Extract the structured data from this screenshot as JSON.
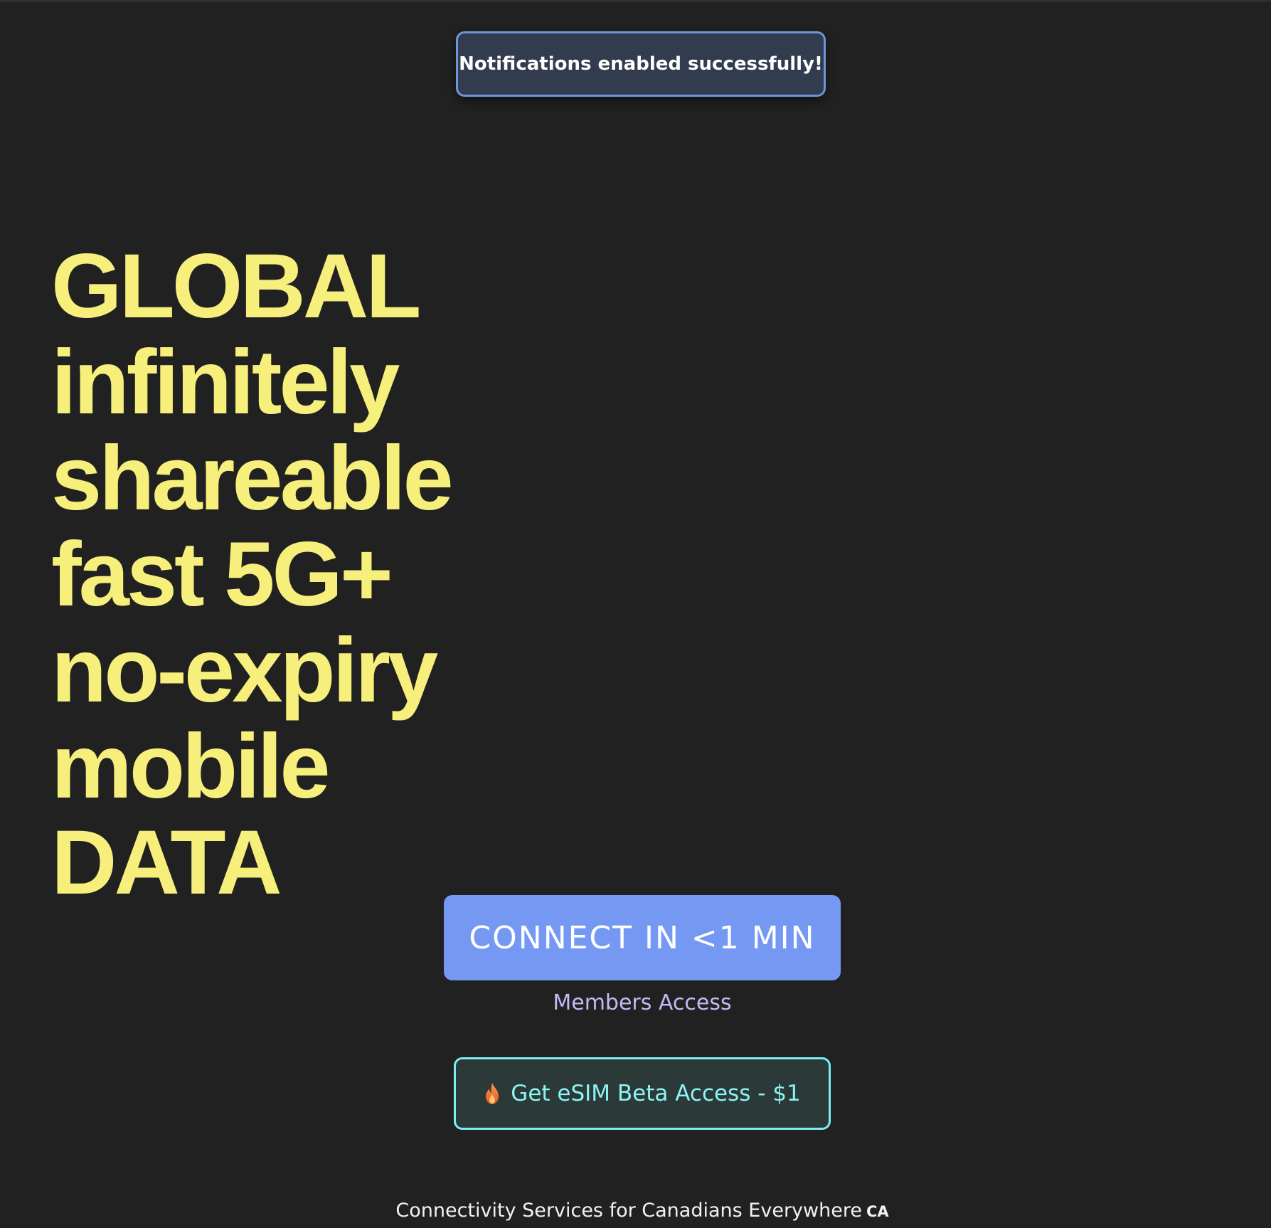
{
  "toast": {
    "message": "Notifications enabled successfully!"
  },
  "hero": {
    "lines": [
      "GLOBAL",
      "infinitely",
      "shareable",
      "fast 5G+",
      "no-expiry",
      "mobile",
      "DATA"
    ]
  },
  "cta": {
    "connect_label": "CONNECT IN <1 MIN",
    "members_label": "Members Access",
    "esim_label": "Get eSIM Beta Access - $1",
    "esim_icon": "fire-icon"
  },
  "footer": {
    "text": "Connectivity Services for Canadians Everywhere",
    "badge": "CA"
  },
  "colors": {
    "background": "#212121",
    "hero_text": "#f7ef7c",
    "toast_bg": "#323c4e",
    "toast_border": "#6e96d6",
    "connect_bg": "#7599f3",
    "members_link": "#c5b8f5",
    "esim_border": "#7ceff0",
    "esim_text": "#8ef3f3"
  }
}
